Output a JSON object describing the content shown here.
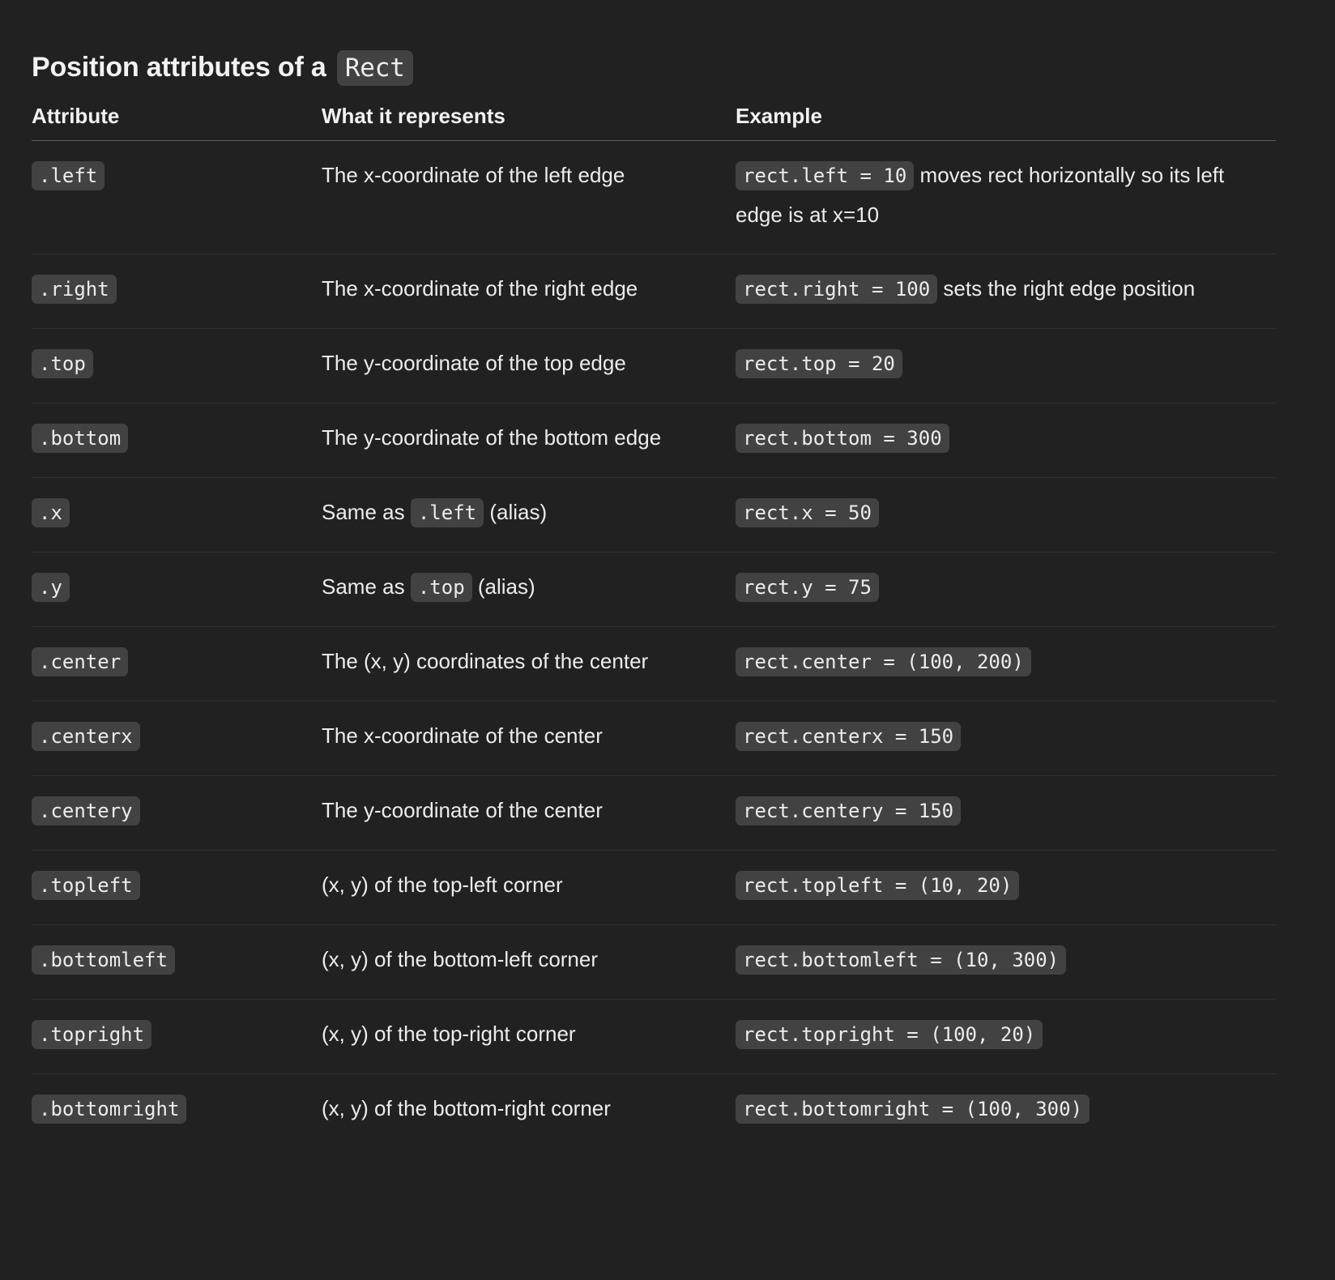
{
  "heading": {
    "text": "Position attributes of a",
    "code": "Rect"
  },
  "table": {
    "headers": [
      "Attribute",
      "What it represents",
      "Example"
    ],
    "rows": [
      {
        "attribute": ".left",
        "meaning": "The x-coordinate of the left edge",
        "example_code": "rect.left = 10",
        "example_text": "moves rect horizontally so its left edge is at x=10"
      },
      {
        "attribute": ".right",
        "meaning": "The x-coordinate of the right edge",
        "example_code": "rect.right = 100",
        "example_text": "sets the right edge position"
      },
      {
        "attribute": ".top",
        "meaning": "The y-coordinate of the top edge",
        "example_code": "rect.top = 20"
      },
      {
        "attribute": ".bottom",
        "meaning": "The y-coordinate of the bottom edge",
        "example_code": "rect.bottom = 300"
      },
      {
        "attribute": ".x",
        "meaning_prefix": "Same as",
        "meaning_code": ".left",
        "meaning_suffix": "(alias)",
        "example_code": "rect.x = 50"
      },
      {
        "attribute": ".y",
        "meaning_prefix": "Same as",
        "meaning_code": ".top",
        "meaning_suffix": "(alias)",
        "example_code": "rect.y = 75"
      },
      {
        "attribute": ".center",
        "meaning": "The (x, y) coordinates of the center",
        "example_code": "rect.center = (100, 200)"
      },
      {
        "attribute": ".centerx",
        "meaning": "The x-coordinate of the center",
        "example_code": "rect.centerx = 150"
      },
      {
        "attribute": ".centery",
        "meaning": "The y-coordinate of the center",
        "example_code": "rect.centery = 150"
      },
      {
        "attribute": ".topleft",
        "meaning": "(x, y) of the top-left corner",
        "example_code": "rect.topleft = (10, 20)"
      },
      {
        "attribute": ".bottomleft",
        "meaning": "(x, y) of the bottom-left corner",
        "example_code": "rect.bottomleft = (10, 300)"
      },
      {
        "attribute": ".topright",
        "meaning": "(x, y) of the top-right corner",
        "example_code": "rect.topright = (100, 20)"
      },
      {
        "attribute": ".bottomright",
        "meaning": "(x, y) of the bottom-right corner",
        "example_code": "rect.bottomright = (100, 300)"
      }
    ]
  }
}
